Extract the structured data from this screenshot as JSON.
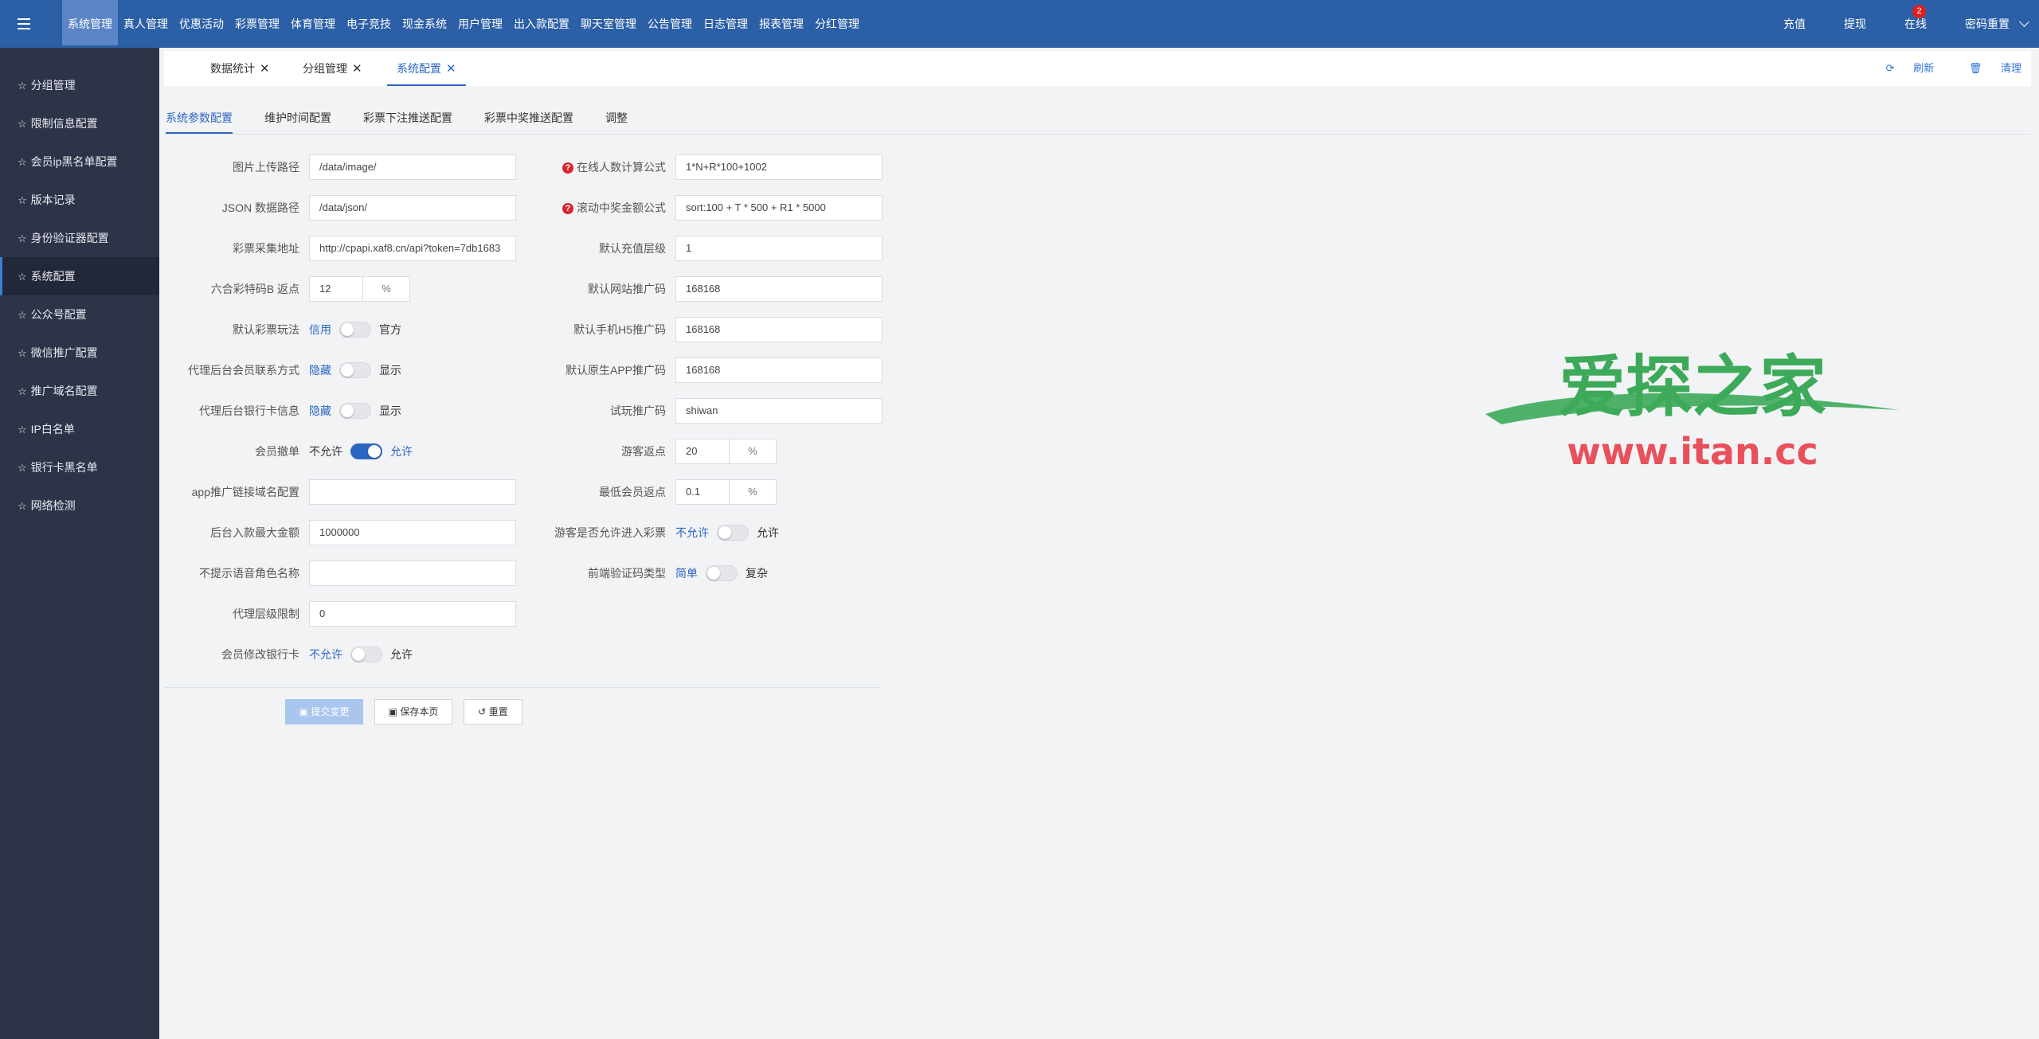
{
  "header": {
    "nav": [
      "系统管理",
      "真人管理",
      "优惠活动",
      "彩票管理",
      "体育管理",
      "电子竞技",
      "现金系统",
      "用户管理",
      "出入款配置",
      "聊天室管理",
      "公告管理",
      "日志管理",
      "报表管理",
      "分红管理"
    ],
    "active_nav": "系统管理",
    "right": {
      "recharge": "充值",
      "withdraw": "提现",
      "online": "在线",
      "online_count": "2",
      "reset_password": "密码重置"
    }
  },
  "sidebar": {
    "items": [
      "分组管理",
      "限制信息配置",
      "会员ip黑名单配置",
      "版本记录",
      "身份验证器配置",
      "系统配置",
      "公众号配置",
      "微信推广配置",
      "推广域名配置",
      "IP白名单",
      "银行卡黑名单",
      "网络检测"
    ],
    "active": "系统配置"
  },
  "page_tabs": {
    "tabs": [
      "数据统计",
      "分组管理",
      "系统配置"
    ],
    "active": "系统配置",
    "close_glyph": "✕",
    "refresh": "刷新",
    "clear": "清理"
  },
  "sub_tabs": {
    "tabs": [
      "系统参数配置",
      "维护时间配置",
      "彩票下注推送配置",
      "彩票中奖推送配置",
      "调整"
    ],
    "active": "系统参数配置"
  },
  "form_left": {
    "image_path": {
      "label": "图片上传路径",
      "value": "/data/image/"
    },
    "json_path": {
      "label": "JSON 数据路径",
      "value": "/data/json/"
    },
    "lottery_url": {
      "label": "彩票采集地址",
      "value": "http://cpapi.xaf8.cn/api?token=7db1683"
    },
    "liuhe_rebate": {
      "label": "六合彩特码B 返点",
      "value": "12",
      "unit": "%"
    },
    "default_play": {
      "label": "默认彩票玩法",
      "off": "信用",
      "on": "官方"
    },
    "agent_contact": {
      "label": "代理后台会员联系方式",
      "off": "隐藏",
      "on": "显示"
    },
    "agent_bank": {
      "label": "代理后台银行卡信息",
      "off": "隐藏",
      "on": "显示"
    },
    "member_cancel": {
      "label": "会员撤单",
      "off": "不允许",
      "on": "允许"
    },
    "app_domain": {
      "label": "app推广链接域名配置",
      "value": ""
    },
    "max_deposit": {
      "label": "后台入款最大金额",
      "value": "1000000"
    },
    "no_voice_roles": {
      "label": "不提示语音角色名称",
      "value": ""
    },
    "agent_level": {
      "label": "代理层级限制",
      "value": "0"
    },
    "member_bank_edit": {
      "label": "会员修改银行卡",
      "off": "不允许",
      "on": "允许"
    }
  },
  "form_right": {
    "online_formula": {
      "label": "在线人数计算公式",
      "value": "1*N+R*100+1002"
    },
    "scroll_formula": {
      "label": "滚动中奖金额公式",
      "value": "sort:100 + T * 500 + R1 * 5000"
    },
    "default_level": {
      "label": "默认充值层级",
      "value": "1"
    },
    "site_promo": {
      "label": "默认网站推广码",
      "value": "168168"
    },
    "h5_promo": {
      "label": "默认手机H5推广码",
      "value": "168168"
    },
    "app_promo": {
      "label": "默认原生APP推广码",
      "value": "168168"
    },
    "trial_promo": {
      "label": "试玩推广码",
      "value": "shiwan"
    },
    "guest_rebate": {
      "label": "游客返点",
      "value": "20",
      "unit": "%"
    },
    "min_member_rebate": {
      "label": "最低会员返点",
      "value": "0.1",
      "unit": "%"
    },
    "guest_lottery": {
      "label": "游客是否允许进入彩票",
      "off": "不允许",
      "on": "允许"
    },
    "captcha_type": {
      "label": "前端验证码类型",
      "off": "简单",
      "on": "复杂"
    }
  },
  "actions": {
    "submit": "提交变更",
    "save_page": "保存本页",
    "reset": "重置"
  },
  "watermark": {
    "title": "爱探之家",
    "url": "www.itan.cc"
  },
  "colors": {
    "header": "#2b5fa6",
    "sidebar": "#2e3448",
    "accent": "#2b67c2",
    "help_icon": "#d9232e",
    "watermark_green": "#3daa5a",
    "watermark_red": "#e8505b"
  }
}
